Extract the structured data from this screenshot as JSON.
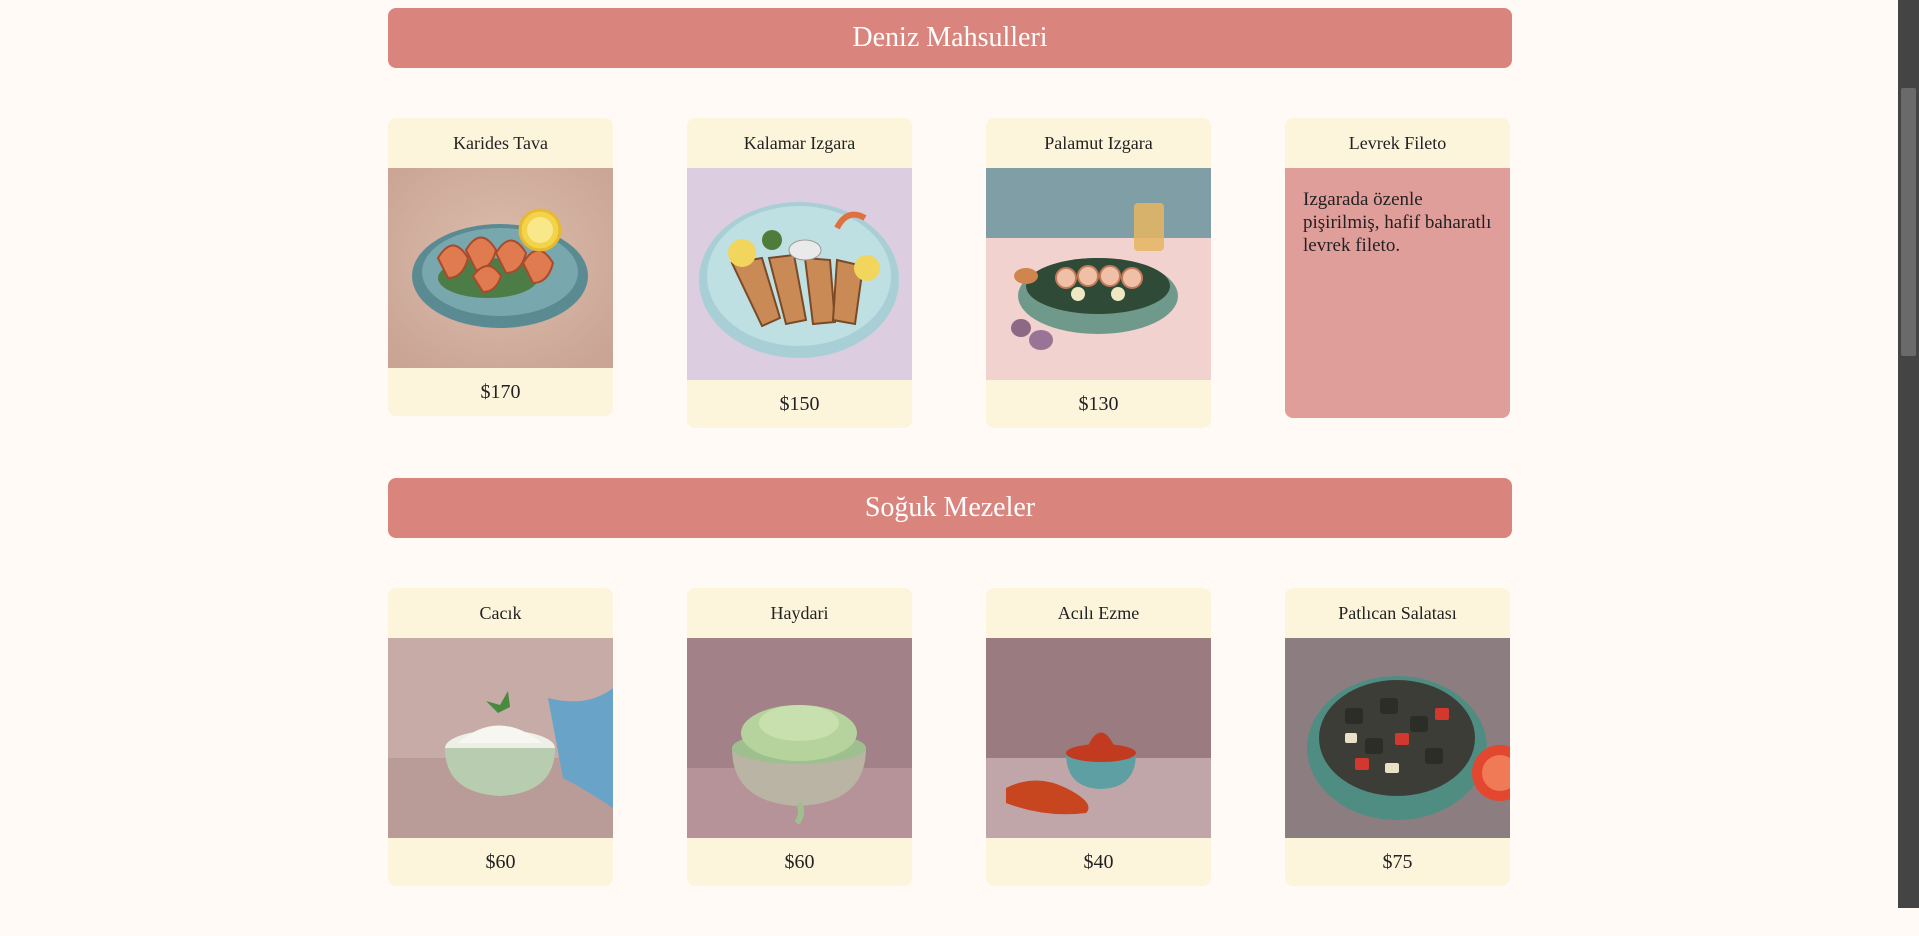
{
  "sections": [
    {
      "title": "Deniz Mahsulleri",
      "items": [
        {
          "name": "Karides Tava",
          "price": "$170",
          "icon": "shrimp-plate"
        },
        {
          "name": "Kalamar Izgara",
          "price": "$150",
          "icon": "grilled-squid-plate"
        },
        {
          "name": "Palamut Izgara",
          "price": "$130",
          "icon": "bonito-bowl"
        },
        {
          "name": "Levrek Fileto",
          "description": "Izgarada özenle pişirilmiş, hafif baharatlı levrek fileto."
        }
      ]
    },
    {
      "title": "Soğuk Mezeler",
      "items": [
        {
          "name": "Cacık",
          "price": "$60",
          "icon": "cacik-bowl"
        },
        {
          "name": "Haydari",
          "price": "$60",
          "icon": "haydari-bowl"
        },
        {
          "name": "Acılı Ezme",
          "price": "$40",
          "icon": "ezme-bowl"
        },
        {
          "name": "Patlıcan Salatası",
          "price": "$75",
          "icon": "eggplant-salad-bowl"
        }
      ]
    }
  ],
  "colors": {
    "banner": "#d9857e",
    "card": "#fdf4dc",
    "description_card": "#e09e9b",
    "page_background": "#fffaf6"
  }
}
